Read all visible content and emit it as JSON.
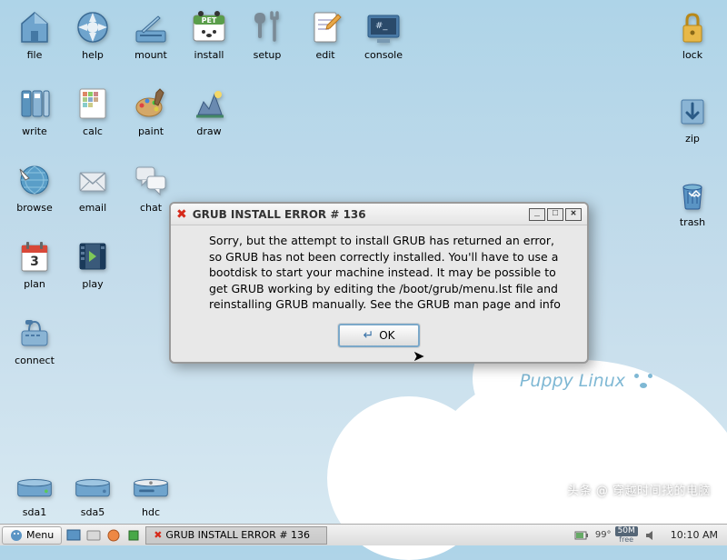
{
  "desktop_icons": {
    "row1": [
      {
        "id": "file",
        "label": "file"
      },
      {
        "id": "help",
        "label": "help"
      },
      {
        "id": "mount",
        "label": "mount"
      },
      {
        "id": "install",
        "label": "install",
        "sub": "PET"
      },
      {
        "id": "setup",
        "label": "setup"
      },
      {
        "id": "edit",
        "label": "edit"
      },
      {
        "id": "console",
        "label": "console"
      }
    ],
    "row2": [
      {
        "id": "write",
        "label": "write"
      },
      {
        "id": "calc",
        "label": "calc"
      },
      {
        "id": "paint",
        "label": "paint"
      },
      {
        "id": "draw",
        "label": "draw"
      }
    ],
    "row3": [
      {
        "id": "browse",
        "label": "browse"
      },
      {
        "id": "email",
        "label": "email"
      },
      {
        "id": "chat",
        "label": "chat"
      }
    ],
    "row4": [
      {
        "id": "plan",
        "label": "plan"
      },
      {
        "id": "play",
        "label": "play"
      }
    ],
    "row5": [
      {
        "id": "connect",
        "label": "connect"
      }
    ],
    "right": [
      {
        "id": "lock",
        "label": "lock"
      },
      {
        "id": "zip",
        "label": "zip"
      },
      {
        "id": "trash",
        "label": "trash"
      }
    ],
    "drives": [
      {
        "id": "sda1",
        "label": "sda1"
      },
      {
        "id": "sda5",
        "label": "sda5"
      },
      {
        "id": "hdc",
        "label": "hdc"
      }
    ]
  },
  "brand": "Puppy Linux",
  "dialog": {
    "title": "GRUB INSTALL ERROR # 136",
    "body": "Sorry, but the attempt to install GRUB has returned an error, so GRUB has not been correctly installed. You'll have to use a bootdisk to start your machine instead. It may be possible to get GRUB working by editing the /boot/grub/menu.lst file and reinstalling GRUB manually. See the GRUB man page and info",
    "ok": "OK"
  },
  "taskbar": {
    "menu": "Menu",
    "task": "GRUB INSTALL ERROR # 136",
    "cpu": "99°",
    "mem_lbl": "free",
    "mem_box": "50M",
    "clock": "10:10 AM"
  },
  "watermark": "头条 @ 穿越时间找的电脑"
}
